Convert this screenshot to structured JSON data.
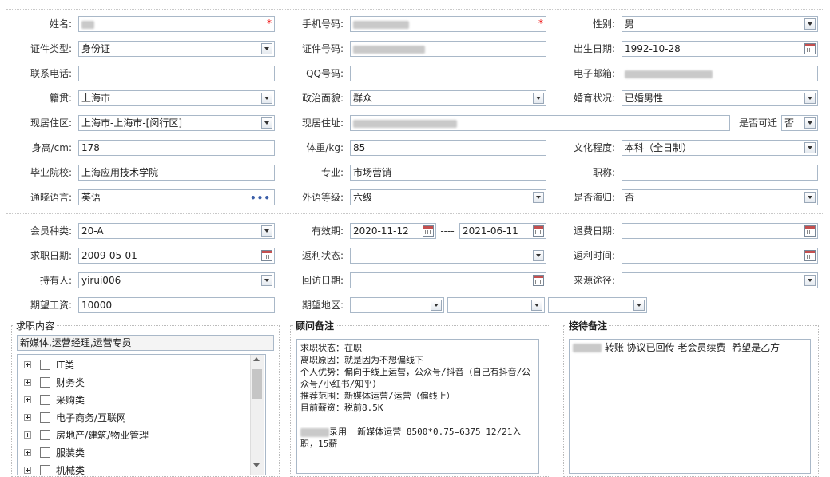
{
  "personal": {
    "name": {
      "label": "姓名:",
      "value": ""
    },
    "mobile": {
      "label": "手机号码:",
      "value": ""
    },
    "gender": {
      "label": "性别:",
      "value": "男"
    },
    "id_type": {
      "label": "证件类型:",
      "value": "身份证"
    },
    "id_number": {
      "label": "证件号码:",
      "value": ""
    },
    "birth_date": {
      "label": "出生日期:",
      "value": "1992-10-28"
    },
    "contact_phone": {
      "label": "联系电话:",
      "value": ""
    },
    "qq": {
      "label": "QQ号码:",
      "value": ""
    },
    "email": {
      "label": "电子邮箱:",
      "value": ""
    },
    "native_place": {
      "label": "籍贯:",
      "value": "上海市"
    },
    "political_status": {
      "label": "政治面貌:",
      "value": "群众"
    },
    "marital_status": {
      "label": "婚育状况:",
      "value": "已婚男性"
    },
    "current_area": {
      "label": "现居住区:",
      "value": "上海市-上海市-[闵行区]"
    },
    "current_address": {
      "label": "现居住址:",
      "value": ""
    },
    "can_relocate": {
      "label": "是否可迁",
      "value": "否"
    },
    "height": {
      "label": "身高/cm:",
      "value": "178"
    },
    "weight": {
      "label": "体重/kg:",
      "value": "85"
    },
    "education": {
      "label": "文化程度:",
      "value": "本科（全日制）"
    },
    "school": {
      "label": "毕业院校:",
      "value": "上海应用技术学院"
    },
    "major": {
      "label": "专业:",
      "value": "市场营销"
    },
    "job_title": {
      "label": "职称:",
      "value": ""
    },
    "language": {
      "label": "通晓语言:",
      "value": "英语"
    },
    "language_level": {
      "label": "外语等级:",
      "value": "六级"
    },
    "overseas_returnee": {
      "label": "是否海归:",
      "value": "否"
    }
  },
  "membership": {
    "member_type": {
      "label": "会员种类:",
      "value": "20-A"
    },
    "valid_period": {
      "label": "有效期:",
      "start": "2020-11-12",
      "separator": "----",
      "end": "2021-06-11"
    },
    "refund_date": {
      "label": "退费日期:",
      "value": ""
    },
    "job_seek_date": {
      "label": "求职日期:",
      "value": "2009-05-01"
    },
    "rebate_status": {
      "label": "返利状态:",
      "value": ""
    },
    "rebate_time": {
      "label": "返利时间:",
      "value": ""
    },
    "holder": {
      "label": "持有人:",
      "value": "yirui006"
    },
    "revisit_date": {
      "label": "回访日期:",
      "value": ""
    },
    "source": {
      "label": "来源途径:",
      "value": ""
    },
    "expected_salary": {
      "label": "期望工资:",
      "value": "10000"
    },
    "expected_area": {
      "label": "期望地区:",
      "values": [
        "",
        "",
        ""
      ]
    }
  },
  "job_content": {
    "title": "求职内容",
    "summary": "新媒体,运营经理,运营专员",
    "categories": [
      "IT类",
      "财务类",
      "采购类",
      "电子商务/互联网",
      "房地产/建筑/物业管理",
      "服装类",
      "机械类"
    ]
  },
  "consultant_notes": {
    "title": "顾问备注",
    "text": "求职状态：在职\n离职原因：就是因为不想偏线下\n个人优势：偏向于线上运营，公众号/抖音（自己有抖音/公众号/小红书/知乎）\n推荐范围：新媒体运营/运营（偏线上）\n目前薪资：税前8.5K\n\n",
    "hire_line": "录用  新媒体运营 8500*0.75=6375 12/21入职，15薪"
  },
  "reception_notes": {
    "title": "接待备注",
    "text": "转账 协议已回传 老会员续费  希望是乙方"
  },
  "colors": {
    "border": "#a9b8c8",
    "required": "#ee0000"
  }
}
